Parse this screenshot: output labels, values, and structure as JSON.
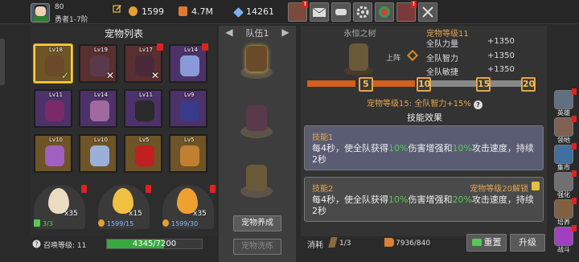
{
  "topbar": {
    "level": "80",
    "rank": "勇者1-7阶",
    "gold": "1599",
    "power": "4.7M",
    "gems": "14261"
  },
  "pet_list": {
    "title": "宠物列表",
    "cards": [
      {
        "lv": "Lv18",
        "color": "#6a4a2a",
        "frame": "gold",
        "selected": true,
        "mark": "✓",
        "dot": false
      },
      {
        "lv": "Lv19",
        "color": "#5a3a4a",
        "frame": "red",
        "selected": false,
        "mark": "✕",
        "dot": false
      },
      {
        "lv": "Lv17",
        "color": "#4a2a3a",
        "frame": "red",
        "selected": false,
        "mark": "✕",
        "dot": true
      },
      {
        "lv": "Lv14",
        "color": "#8a9ad8",
        "frame": "purple",
        "selected": false,
        "mark": "",
        "dot": true
      },
      {
        "lv": "Lv11",
        "color": "#7a2a6a",
        "frame": "purple",
        "selected": false,
        "mark": "",
        "dot": false
      },
      {
        "lv": "Lv14",
        "color": "#a06aa0",
        "frame": "purple",
        "selected": false,
        "mark": "",
        "dot": false
      },
      {
        "lv": "Lv11",
        "color": "#2a2a2a",
        "frame": "purple",
        "selected": false,
        "mark": "",
        "dot": false
      },
      {
        "lv": "Lv9",
        "color": "#3a3a8a",
        "frame": "purple",
        "selected": false,
        "mark": "",
        "dot": false
      },
      {
        "lv": "Lv10",
        "color": "#a060c0",
        "frame": "gold",
        "selected": false,
        "mark": "",
        "dot": false
      },
      {
        "lv": "Lv10",
        "color": "#9ab0d8",
        "frame": "gold",
        "selected": false,
        "mark": "",
        "dot": false
      },
      {
        "lv": "Lv5",
        "color": "#c02020",
        "frame": "gold",
        "selected": false,
        "mark": "",
        "dot": false
      },
      {
        "lv": "Lv5",
        "color": "#c08030",
        "frame": "gold",
        "selected": false,
        "mark": "",
        "dot": false
      }
    ]
  },
  "eggs": [
    {
      "count": "x35",
      "sub": "3/3",
      "sub_color": "#58c858",
      "egg_color": "#e9dcc0",
      "icon": "ticket-icon"
    },
    {
      "count": "x15",
      "sub": "1599/15",
      "sub_color": "#8ab8ff",
      "egg_color": "#f0c040",
      "icon": "gold-icon"
    },
    {
      "count": "x35",
      "sub": "1599/30",
      "sub_color": "#8ab8ff",
      "egg_color": "#f0a030",
      "icon": "gold-icon"
    }
  ],
  "summon": {
    "label": "召唤等级: 11",
    "value": "4345/7200",
    "progress": 0.6035
  },
  "team": {
    "title": "队伍1",
    "train_btn": "宠物养成",
    "synth_btn": "宠物洗练"
  },
  "detail": {
    "name": "永恒之树",
    "level": "宠物等级11",
    "deploy": "上阵",
    "stats": [
      {
        "label": "全队力量",
        "value": "+1350"
      },
      {
        "label": "全队智力",
        "value": "+1350"
      },
      {
        "label": "全队敏捷",
        "value": "+1350"
      }
    ],
    "milestones": [
      "5",
      "10",
      "15",
      "20"
    ],
    "bonus": "宠物等级15: 全队智力+15%",
    "skills_title": "技能效果",
    "skill1_title": "技能1",
    "skill1_desc": [
      "每4秒，使全队获得",
      "10%",
      "伤害增强和",
      "10%",
      "攻击速度，持续2秒"
    ],
    "skill2_title": "技能2",
    "skill2_unlock": "宠物等级20解锁",
    "skill2_desc": [
      "每4秒，使全队获得",
      "10%",
      "伤害增强和",
      "20%",
      "攻击速度，持续2秒"
    ]
  },
  "action": {
    "consume_label": "消耗",
    "consume_val": "1/3",
    "key_val": "7936/840",
    "reset_btn": "重置",
    "upgrade_btn": "升级"
  },
  "sidebar": [
    {
      "label": "英雄",
      "color": "#607080"
    },
    {
      "label": "领地",
      "color": "#806050"
    },
    {
      "label": "集市",
      "color": "#4070a0"
    },
    {
      "label": "强化",
      "color": "#707070"
    },
    {
      "label": "培养",
      "color": "#806040"
    },
    {
      "label": "战斗",
      "color": "#a040c0"
    }
  ]
}
